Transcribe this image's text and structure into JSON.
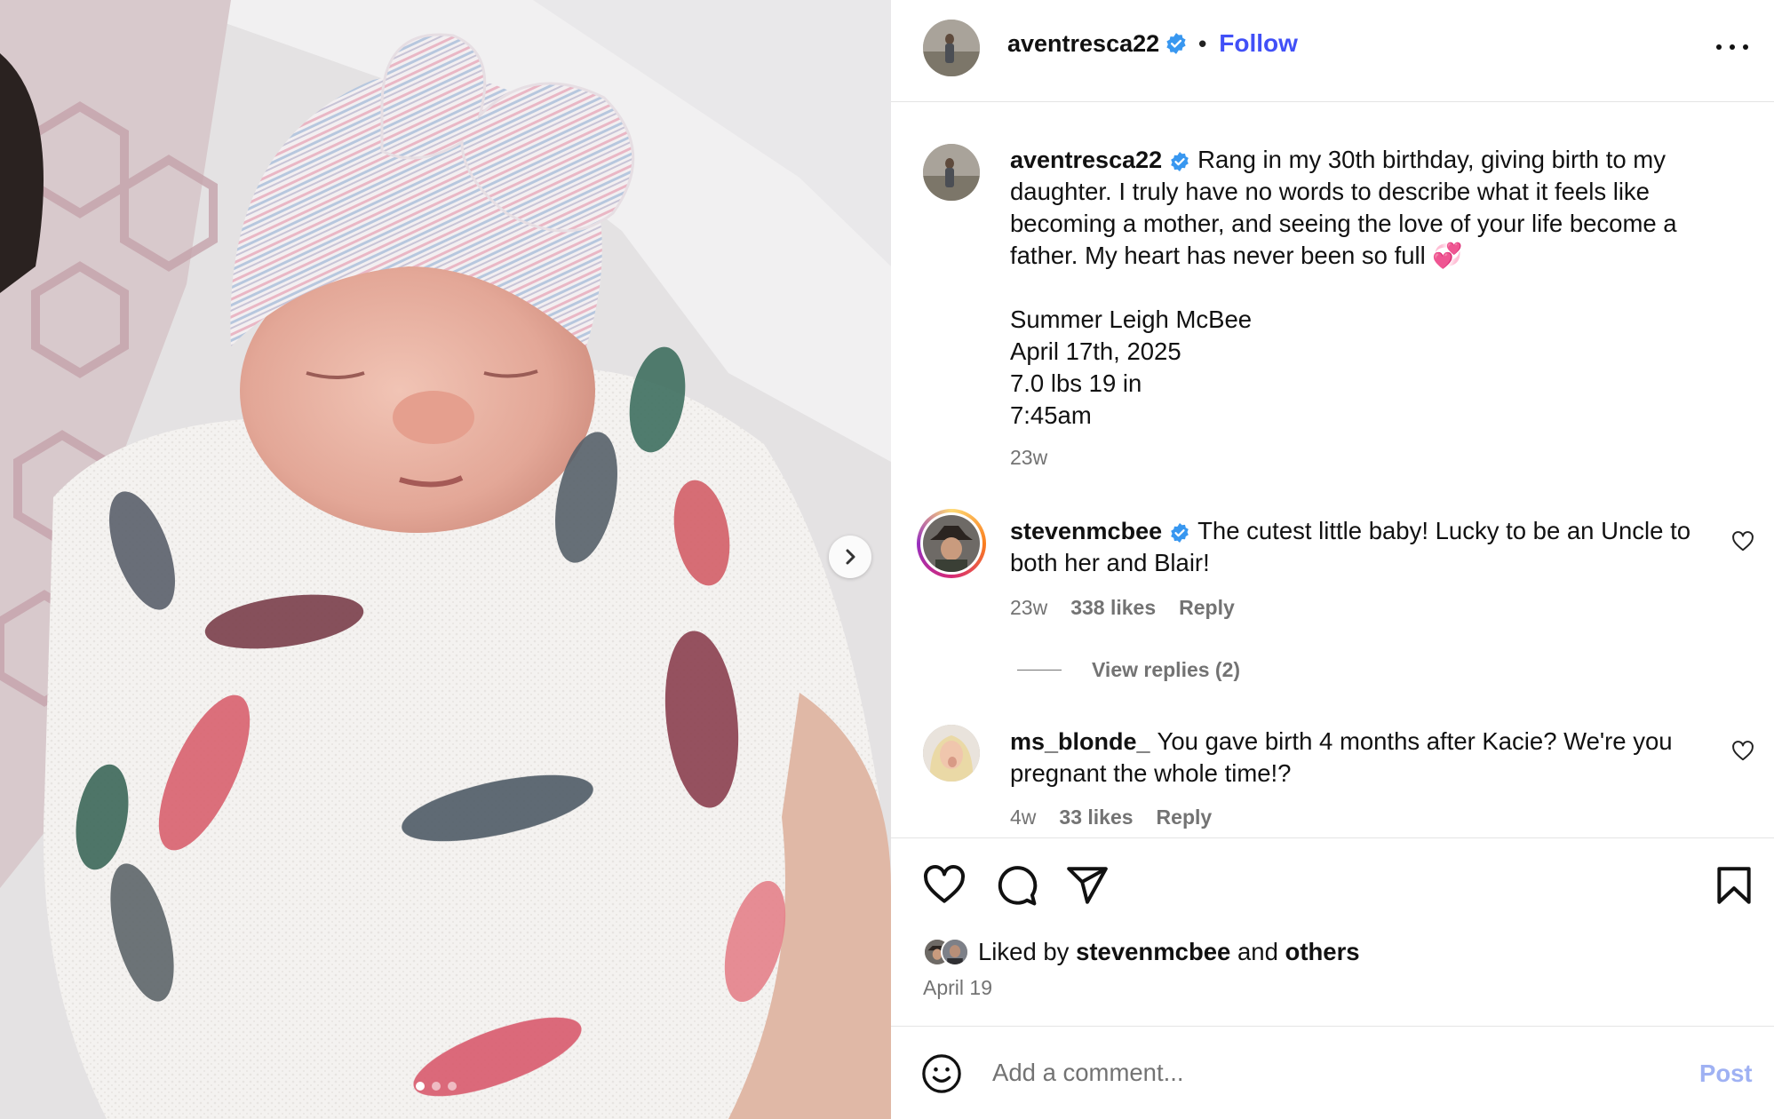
{
  "header": {
    "username": "aventresca22",
    "follow_label": "Follow"
  },
  "caption": {
    "username": "aventresca22",
    "body": "Rang in my 30th birthday, giving birth to my daughter. I truly have no words to describe what it feels like becoming a mother, and seeing the love of your life become a father. My heart has never been so full 💞",
    "details": [
      "Summer Leigh McBee",
      "April 17th, 2025",
      "7.0 lbs 19 in",
      "7:45am"
    ],
    "time": "23w"
  },
  "comments": [
    {
      "username": "stevenmcbee",
      "verified": true,
      "text": "The cutest little baby! Lucky to be an Uncle to both her and Blair!",
      "time": "23w",
      "likes": "338 likes",
      "reply_label": "Reply",
      "view_replies": "View replies (2)"
    },
    {
      "username": "ms_blonde_",
      "verified": false,
      "text": "You gave birth 4 months after Kacie? We're you pregnant the whole time!?",
      "time": "4w",
      "likes": "33 likes",
      "reply_label": "Reply"
    }
  ],
  "likes": {
    "prefix": "Liked by",
    "user": "stevenmcbee",
    "conjunction": "and",
    "others": "others"
  },
  "post_date": "April 19",
  "composer": {
    "placeholder": "Add a comment...",
    "post_label": "Post"
  },
  "carousel": {
    "total": 3,
    "current": 1
  },
  "colors": {
    "follow": "#4150f7",
    "verified": "#3897f0",
    "secondary_text": "#737373",
    "post_disabled": "#9fb1f3"
  },
  "icons": [
    "verified-badge-icon",
    "more-options-icon",
    "chevron-right-icon",
    "heart-icon",
    "comment-icon",
    "share-icon",
    "bookmark-icon",
    "emoji-icon"
  ]
}
